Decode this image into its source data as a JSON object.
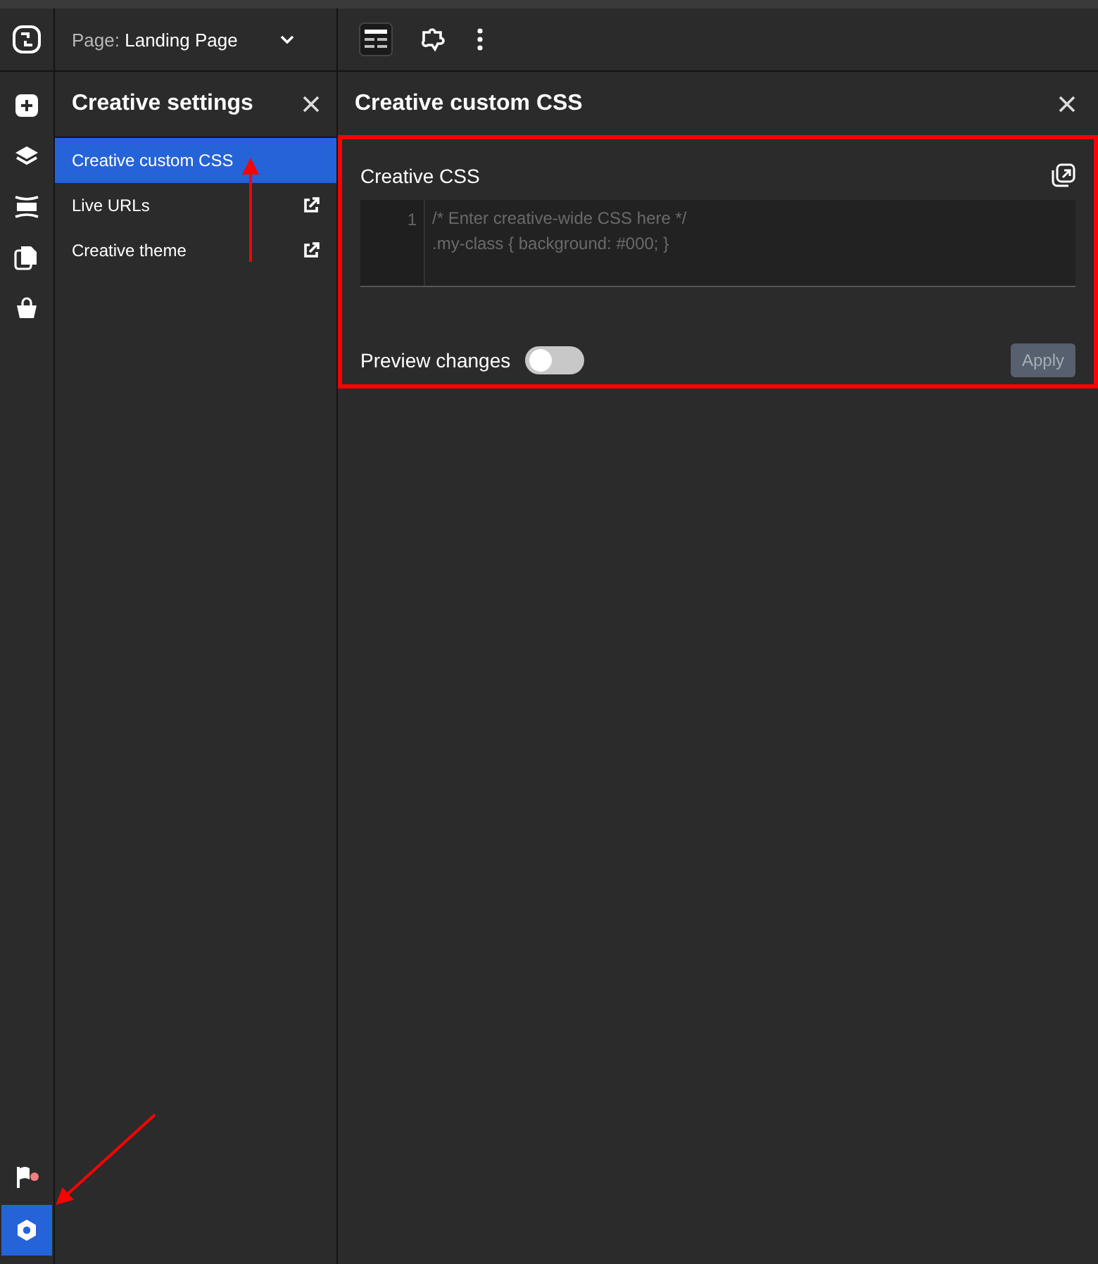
{
  "toolbar": {
    "page_label": "Page:",
    "page_name": "Landing Page"
  },
  "rail": {
    "top": [
      {
        "kind": "add",
        "selected": false
      },
      {
        "kind": "layers",
        "selected": false
      },
      {
        "kind": "rows",
        "selected": false
      },
      {
        "kind": "pages",
        "selected": false
      },
      {
        "kind": "bag",
        "selected": false
      }
    ],
    "bottom": [
      {
        "kind": "flag",
        "selected": false
      },
      {
        "kind": "gear",
        "selected": true
      }
    ]
  },
  "settings_panel": {
    "title": "Creative settings",
    "items": [
      {
        "label": "Creative custom CSS",
        "selected": true,
        "external": false
      },
      {
        "label": "Live URLs",
        "selected": false,
        "external": true
      },
      {
        "label": "Creative theme",
        "selected": false,
        "external": true
      }
    ]
  },
  "css_panel": {
    "title": "Creative custom CSS",
    "section_title": "Creative CSS",
    "editor": {
      "line_number": "1",
      "placeholder": [
        "/* Enter creative-wide CSS here */",
        ".my-class { background: #000; }"
      ]
    },
    "preview": {
      "label": "Preview changes",
      "on": false
    },
    "apply_button": {
      "label": "Apply",
      "disabled": true
    }
  }
}
